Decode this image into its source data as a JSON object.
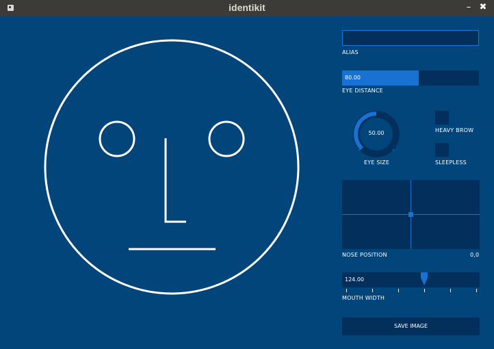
{
  "window": {
    "title": "identikit",
    "minimize_glyph": "–",
    "close_glyph": "✖"
  },
  "colors": {
    "background": "#02457a",
    "control_bg": "#022f5c",
    "accent": "#1772d4",
    "foreground": "#ffffff"
  },
  "controls": {
    "alias": {
      "label": "ALIAS",
      "value": ""
    },
    "eye_distance": {
      "label": "EYE DISTANCE",
      "value_text": "80.00",
      "fill_fraction": 0.56
    },
    "eye_size": {
      "label": "EYE SIZE",
      "value_text": "50.00",
      "fraction": 0.5
    },
    "heavy_brow": {
      "label": "HEAVY BROW",
      "checked": false
    },
    "sleepless": {
      "label": "SLEEPLESS",
      "checked": false
    },
    "nose_position": {
      "label": "NOSE POSITION",
      "value_text": "0,0"
    },
    "mouth_width": {
      "label": "MOUTH WIDTH",
      "value_text": "124.00",
      "fraction": 0.6
    },
    "save": {
      "label": "SAVE IMAGE"
    }
  }
}
